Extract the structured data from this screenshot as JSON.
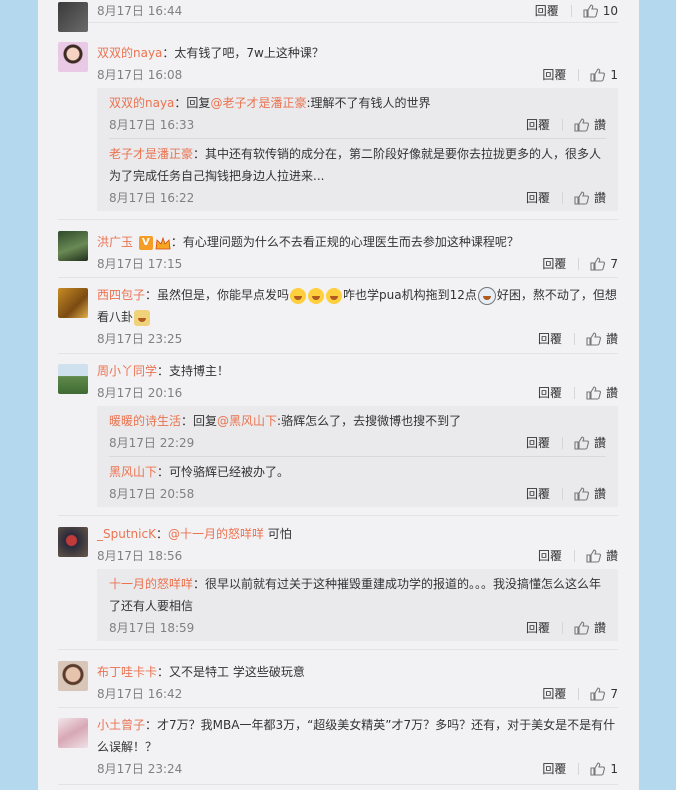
{
  "ui": {
    "reply_label": "回覆"
  },
  "comments": [
    {
      "user": "",
      "text": "",
      "time": "8月17日 16:44",
      "likes": "10"
    },
    {
      "user": "双双的naya",
      "text": "：太有钱了吧，7w上这种课？",
      "time": "8月17日 16:08",
      "likes": "1",
      "replies": [
        {
          "user": "双双的naya",
          "pre": "：回复",
          "mention": "@老子才是潘正豪",
          "text": ":理解不了有钱人的世界",
          "time": "8月17日 16:33",
          "likes": "讚"
        },
        {
          "user": "老子才是潘正豪",
          "text": "：其中还有软传销的成分在，第二阶段好像就是要你去拉拢更多的人，很多人为了完成任务自己掏钱把身边人拉进来...",
          "time": "8月17日 16:22",
          "likes": "讚"
        }
      ]
    },
    {
      "user": "洪广玉",
      "text": "：有心理问题为什么不去看正规的心理医生而去参加这种课程呢？",
      "time": "8月17日 17:15",
      "likes": "7"
    },
    {
      "user": "西四包子",
      "text1": "：虽然但是，你能早点发吗",
      "text2": "咋也学pua机构拖到12点",
      "text3": "好困，熬不动了，但想看八卦",
      "time": "8月17日 23:25",
      "likes": "讚"
    },
    {
      "user": "周小丫同学",
      "text": "：支持博主！",
      "time": "8月17日 20:16",
      "likes": "讚",
      "replies": [
        {
          "user": "暖暖的诗生活",
          "pre": "：回复",
          "mention": "@黑风山下",
          "text": ":骆辉怎么了，去搜微博也搜不到了",
          "time": "8月17日 22:29",
          "likes": "讚"
        },
        {
          "user": "黑风山下",
          "text": "：可怜骆辉已经被办了。",
          "time": "8月17日 20:58",
          "likes": "讚"
        }
      ]
    },
    {
      "user": "_SputnicK",
      "pre": "：",
      "mention": "@十一月的怒咩咩",
      "text": " 可怕",
      "time": "8月17日 18:56",
      "likes": "讚",
      "replies": [
        {
          "user": "十一月的怒咩咩",
          "text": "：很早以前就有过关于这种摧毁重建成功学的报道的。。。我没搞懂怎么这么年了还有人要相信",
          "time": "8月17日 18:59",
          "likes": "讚"
        }
      ]
    },
    {
      "user": "布丁哇卡卡",
      "text": "：又不是特工 学这些破玩意",
      "time": "8月17日 16:42",
      "likes": "7"
    },
    {
      "user": "小土曾子",
      "text": "：才7万？我MBA一年都3万，“超级美女精英”才7万？多吗？还有，对于美女是不是有什么误解！？",
      "time": "8月17日 23:24",
      "likes": "1"
    }
  ]
}
